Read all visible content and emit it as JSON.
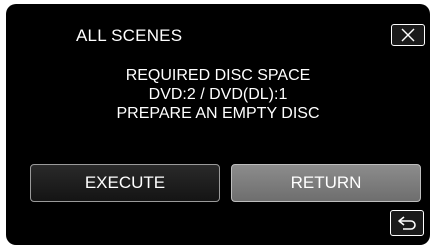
{
  "dialog": {
    "title": "ALL SCENES",
    "message_lines": [
      "REQUIRED DISC SPACE",
      "DVD:2 / DVD(DL):1",
      "PREPARE AN EMPTY DISC"
    ]
  },
  "buttons": {
    "execute_label": "EXECUTE",
    "return_label": "RETURN"
  },
  "icons": {
    "close": "close-icon",
    "back": "back-arrow-icon"
  },
  "colors": {
    "background": "#000000",
    "text": "#ffffff",
    "return_button": "#7d7d7d",
    "execute_button": "#1e1e1e"
  }
}
